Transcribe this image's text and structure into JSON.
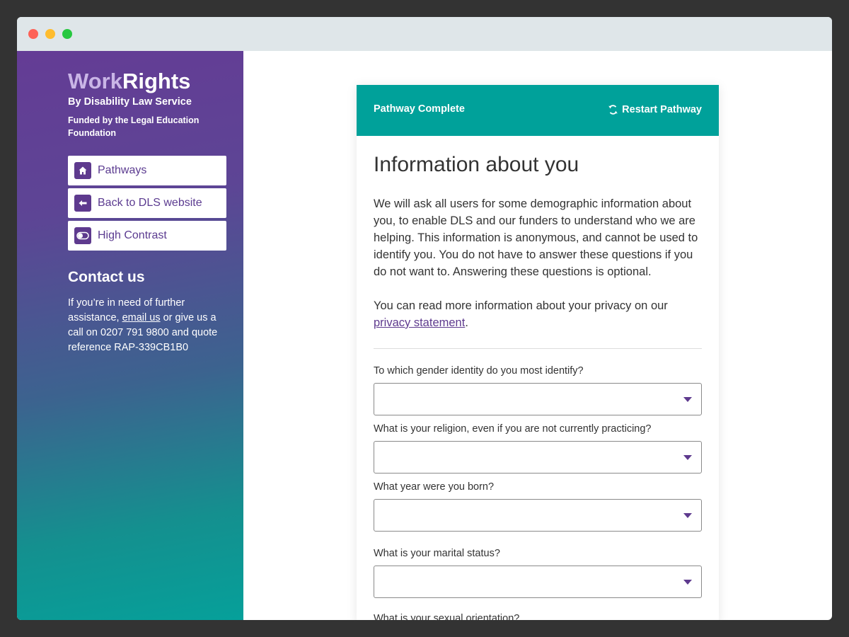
{
  "brand": {
    "work": "Work",
    "rights": "Rights",
    "byline": "By Disability Law Service",
    "funded": "Funded by the Legal Education Foundation"
  },
  "nav": [
    {
      "label": "Pathways",
      "icon": "home-icon"
    },
    {
      "label": "Back to DLS website",
      "icon": "arrow-left-icon"
    },
    {
      "label": "High Contrast",
      "icon": "toggle-icon"
    }
  ],
  "contact": {
    "heading": "Contact us",
    "text_before": "If you’re in need of further assistance,",
    "link": "email us",
    "text_after": "or give us a call on 0207 791 9800 and quote reference RAP-339CB1B0"
  },
  "card": {
    "header_left": "Pathway Complete",
    "restart_label": "Restart Pathway",
    "title": "Information about you",
    "para1": "We will ask all users for some demographic information about you, to enable DLS and our funders to understand who we are helping. This information is anonymous, and cannot be used to identify you. You do not have to answer these questions if you do not want to. Answering these questions is optional.",
    "para2_before": "You can read more information about your privacy on our",
    "para2_link": "privacy statement",
    "para2_after": ".",
    "questions": [
      {
        "label": "To which gender identity do you most identify?",
        "value": ""
      },
      {
        "label": "What is your religion, even if you are not currently practicing?",
        "value": ""
      },
      {
        "label": "What year were you born?",
        "value": ""
      },
      {
        "label": "What is your marital status?",
        "value": ""
      },
      {
        "label": "What is your sexual orientation?",
        "value": ""
      }
    ]
  },
  "colors": {
    "accent_teal": "#00a19a",
    "brand_purple": "#5e3a8e",
    "titlebar": "#dfe6e9"
  }
}
